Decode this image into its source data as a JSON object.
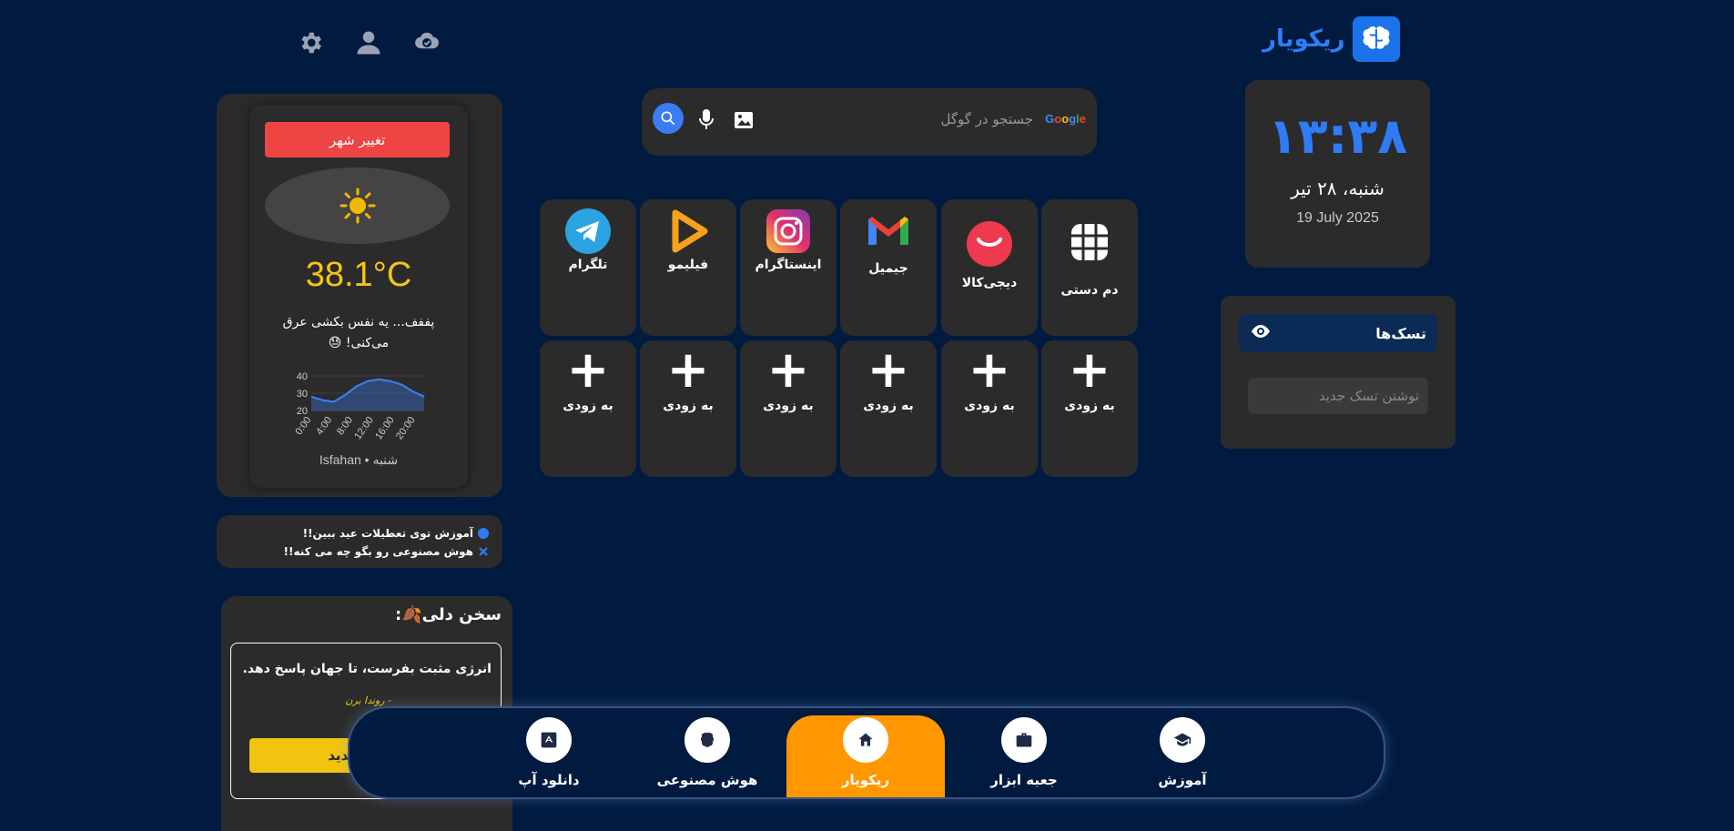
{
  "header": {
    "logo_text": "ریکویار",
    "icons": [
      "settings-icon",
      "user-icon",
      "weather-badge-icon"
    ]
  },
  "clock": {
    "time": "۱۳:۳۸",
    "date_fa": "شنبه، ۲۸ تیر",
    "date_en": "19 July 2025"
  },
  "tasks": {
    "title": "تسک‌ها",
    "input_placeholder": "نوشتن تسک جدید"
  },
  "search": {
    "placeholder": "جستجو در گوگل",
    "google_label": "Google"
  },
  "apps": {
    "row1": [
      "دم دستی",
      "دیجی‌کالا",
      "جیمیل",
      "اینستاگرام",
      "فیلیمو",
      "تلگرام"
    ],
    "row2_label": "به زودی"
  },
  "weather": {
    "change_city_label": "تغییر شهر",
    "temperature": "38.1°C",
    "message": "پففف... یه نفس بکشی عرق می‌کنی! 😓",
    "footer": "Isfahan • شنبه",
    "chart_data": {
      "type": "area",
      "x": [
        "0:00",
        "4:00",
        "8:00",
        "12:00",
        "16:00",
        "20:00"
      ],
      "y_ticks": [
        20,
        30,
        40
      ],
      "ylim": [
        20,
        40
      ],
      "values": [
        28,
        26,
        25,
        29,
        34,
        37,
        38,
        37,
        35,
        31,
        28
      ],
      "color": "#3b82f6"
    }
  },
  "news": {
    "items": [
      "آموزش توی تعطیلات عید ببین!!",
      "هوش مصنوعی رو بگو چه می کنه!!"
    ]
  },
  "quote": {
    "title": "سخن دلی🍂:",
    "text": "انرژی مثبت بفرست، تا جهان پاسخ دهد.",
    "author": "- روندا برن",
    "button": "جدید"
  },
  "nav": {
    "items": [
      "دانلود آپ",
      "هوش مصنوعی",
      "ریکویار",
      "جعبه ابزار",
      "آموزش"
    ],
    "active": "ریکویار",
    "active_color": "#ff9800"
  },
  "colors": {
    "background": "#001a40",
    "card": "#2b2b2b",
    "accent_blue": "#2f7cf6",
    "danger": "#ef4444",
    "yellow": "#f1c40f"
  }
}
